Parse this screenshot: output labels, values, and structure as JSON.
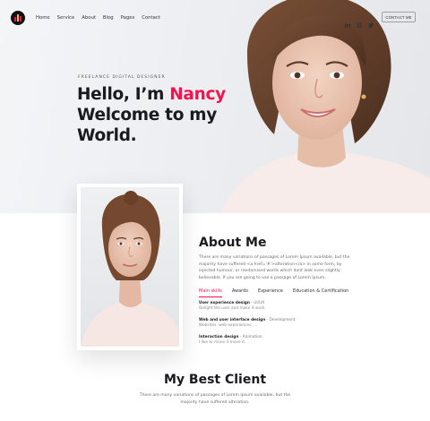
{
  "header": {
    "logo_icon": "bar-chart-logo-icon",
    "nav": [
      "Home",
      "Service",
      "About",
      "Blog",
      "Pages",
      "Contact"
    ],
    "social_icons": [
      "linkedin-icon",
      "instagram-icon",
      "twitter-icon"
    ],
    "contact_button": "CONTACT ME"
  },
  "hero": {
    "eyebrow": "FREELANCE DIGITAL DESIGNER",
    "greeting": "Hello, I’m ",
    "name": "Nancy",
    "line2": "Welcome to my",
    "line3": "World.",
    "accent_color": "#f4134f"
  },
  "about": {
    "title": "About Me",
    "text": "There are many variations of passages of Lorem Ipsum available, but the majority have suffered <a href='#'>alteration</a> in some form, by injected humour, or randomised words which dont look even slightly believable. If you are going to use a passage of Lorem Ipsum.",
    "tabs": [
      "Main skills",
      "Awards",
      "Experience",
      "Education & Certification"
    ],
    "active_tab": "Main skills",
    "skills": [
      {
        "title": "User experience design",
        "sub": " - UI/UX",
        "desc": "Delight the user and make it work."
      },
      {
        "title": "Web and user interface design",
        "sub": " - Development",
        "desc": "Websites, web experiences, ..."
      },
      {
        "title": "Interaction design",
        "sub": " - Animation",
        "desc": "I like to move it move it."
      }
    ]
  },
  "clients": {
    "title": "My Best Client",
    "text": "There are many variations of passages of Lorem Ipsum available, but the majority have suffered alteration."
  }
}
